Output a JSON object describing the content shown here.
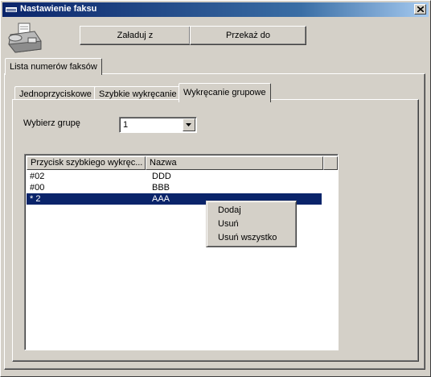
{
  "window": {
    "title": "Nastawienie faksu",
    "close_symbol": "×"
  },
  "toolbar": {
    "load_label": "Załaduj z",
    "send_label": "Przekaż do"
  },
  "outer_tab": {
    "label": "Lista numerów faksów"
  },
  "inner_tabs": [
    {
      "label": "Jednoprzyciskowe"
    },
    {
      "label": "Szybkie wykręcanie"
    },
    {
      "label": "Wykręcanie grupowe"
    }
  ],
  "group_select": {
    "label": "Wybierz grupę",
    "value": "1"
  },
  "list": {
    "columns": [
      "Przycisk szybkiego wykręc...",
      "Nazwa"
    ],
    "rows": [
      {
        "key": "#02",
        "name": "DDD"
      },
      {
        "key": "#00",
        "name": "BBB"
      },
      {
        "key": "* 2",
        "name": "AAA"
      }
    ],
    "selected_index": 2
  },
  "context_menu": {
    "items": [
      "Dodaj",
      "Usuń",
      "Usuń wszystko"
    ]
  },
  "icons": {
    "title_icon": "fax-app-icon",
    "fax_icon": "fax-machine-icon",
    "close_icon": "close-icon",
    "dropdown_icon": "chevron-down-icon"
  },
  "colors": {
    "titlebar_start": "#0a246a",
    "titlebar_end": "#a6caf0",
    "selection": "#0a246a",
    "face": "#d4d0c8"
  }
}
